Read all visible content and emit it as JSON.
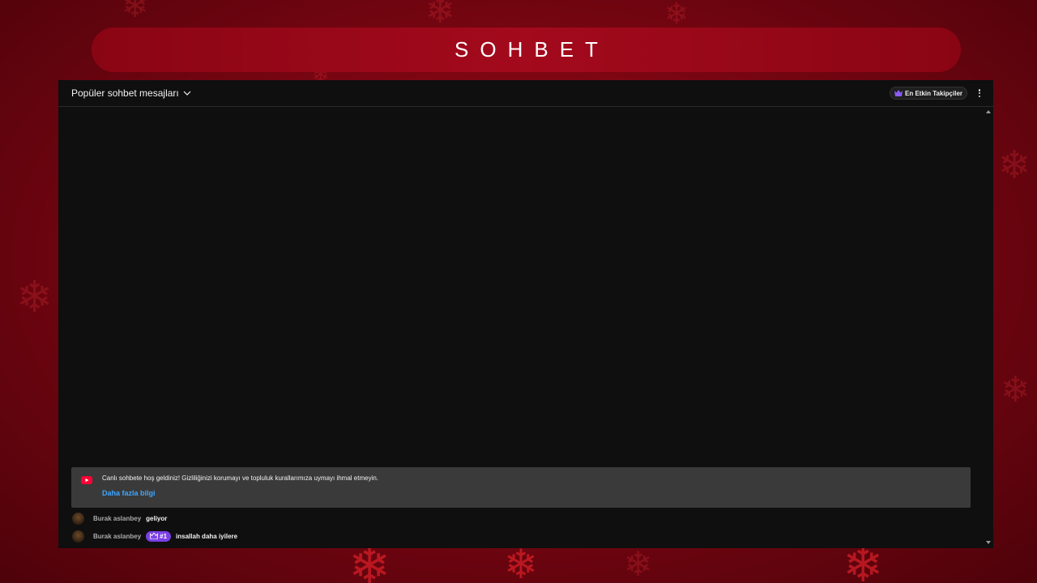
{
  "header": {
    "title": "SOHBET"
  },
  "chat": {
    "mode_label": "Popüler sohbet mesajları",
    "top_fans_label": "En Etkin Takipçiler",
    "welcome": {
      "text": "Canlı sohbete hoş geldiniz! Gizliliğinizi korumayı ve topluluk kurallarımıza uymayı ihmal etmeyin.",
      "link": "Daha fazla bilgi"
    },
    "messages": [
      {
        "author": "Burak aslanbey",
        "badge": "",
        "text": "geliyor"
      },
      {
        "author": "Burak aslanbey",
        "badge": "#1",
        "text": "insallah daha iyilere"
      }
    ]
  },
  "icons": {
    "dropdown": "chevron-down-icon",
    "top_fans": "crown-icon",
    "menu": "more-vert-icon",
    "welcome": "youtube-icon",
    "badge": "crown-icon"
  },
  "colors": {
    "background": "#7a0612",
    "title_bar": "#a30a1c",
    "chat_bg": "#0f0f0f",
    "welcome_bg": "#3a3a3a",
    "link": "#3ea6ff",
    "badge": "#7b3fe4"
  }
}
